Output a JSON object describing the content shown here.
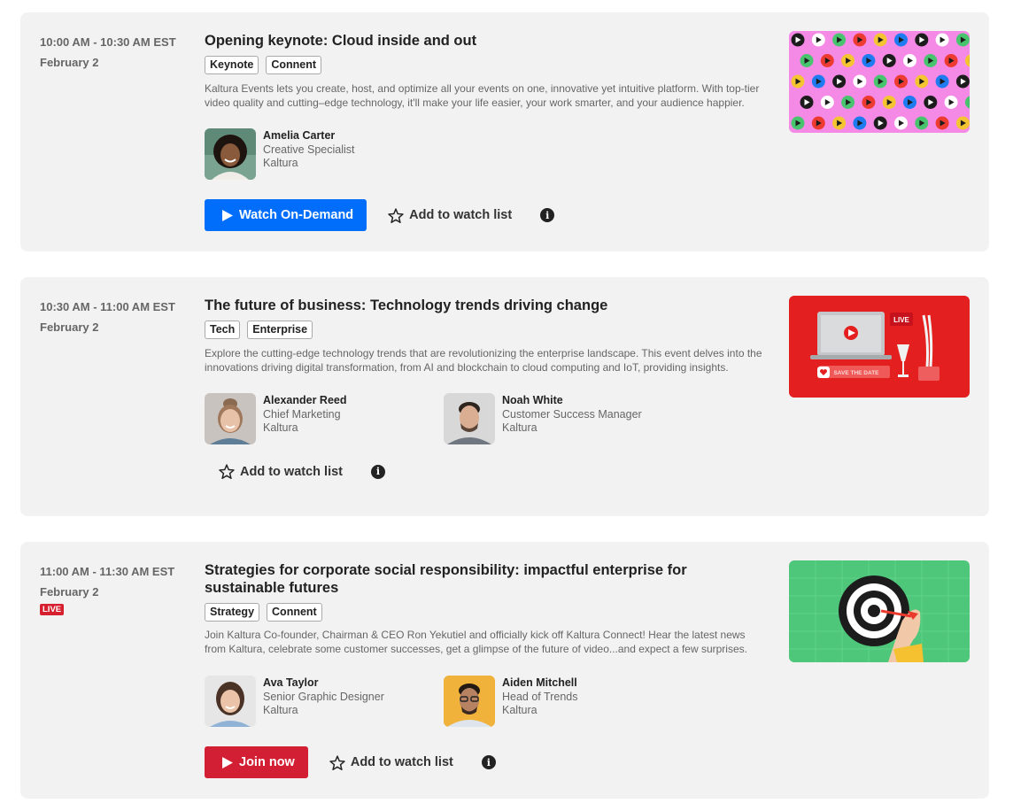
{
  "sessions": [
    {
      "time": "10:00 AM - 10:30 AM EST",
      "date": "February 2",
      "title": "Opening keynote: Cloud inside and out",
      "tags": [
        "Keynote",
        "Connent"
      ],
      "description": "Kaltura Events lets you create, host, and optimize all your events on one, innovative yet intuitive platform. With top-tier video quality and cutting–edge technology, it'll make your life easier, your work smarter, and your audience happier.",
      "speakers": [
        {
          "name": "Amelia Carter",
          "role": "Creative Specialist",
          "company": "Kaltura"
        }
      ],
      "primary_button": "Watch On-Demand",
      "watch_label": "Add to watch list",
      "thumbnail": "play-icons-pattern"
    },
    {
      "time": "10:30 AM - 11:00 AM EST",
      "date": "February 2",
      "title": "The future of business: Technology trends driving change",
      "tags": [
        "Tech",
        "Enterprise"
      ],
      "description": "Explore the cutting-edge technology trends that are revolutionizing the enterprise landscape. This event delves into the innovations driving digital transformation, from AI and blockchain to cloud computing and IoT, providing insights.",
      "speakers": [
        {
          "name": "Alexander Reed",
          "role": "Chief Marketing",
          "company": "Kaltura"
        },
        {
          "name": "Noah White",
          "role": "Customer Success Manager",
          "company": "Kaltura"
        }
      ],
      "watch_label": "Add to watch list",
      "thumbnail": "live-event-laptop",
      "thumb_live": "LIVE",
      "thumb_save": "SAVE THE DATE"
    },
    {
      "time": "11:00 AM - 11:30 AM EST",
      "date": "February 2",
      "live_badge": "LIVE",
      "title": "Strategies for corporate social responsibility: impactful enterprise for sustainable futures",
      "tags": [
        "Strategy",
        "Connent"
      ],
      "description": "Join Kaltura Co-founder, Chairman & CEO Ron Yekutiel and officially kick off Kaltura Connect! Hear the latest news from Kaltura, celebrate some customer successes, get a glimpse of the future of video...and expect a few surprises.",
      "speakers": [
        {
          "name": "Ava Taylor",
          "role": "Senior Graphic Designer",
          "company": "Kaltura"
        },
        {
          "name": "Aiden Mitchell",
          "role": "Head of Trends",
          "company": "Kaltura"
        }
      ],
      "primary_button": "Join now",
      "watch_label": "Add to watch list",
      "thumbnail": "dartboard-target"
    }
  ],
  "colors": {
    "blue_button": "#006efa",
    "red_button": "#d31f33",
    "card_bg": "#f2f2f2"
  }
}
